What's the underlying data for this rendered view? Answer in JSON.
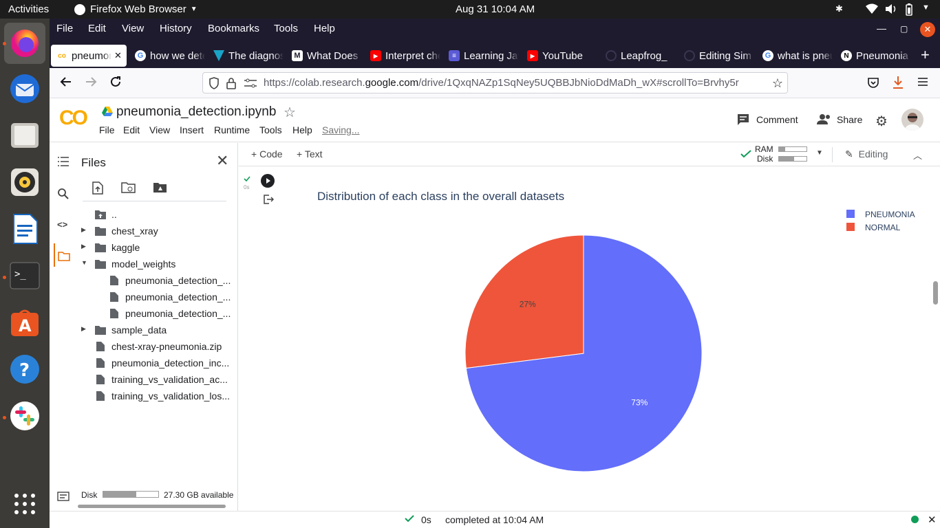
{
  "system": {
    "activities": "Activities",
    "app_name": "Firefox Web Browser",
    "clock": "Aug 31  10:04 AM"
  },
  "firefox": {
    "menu": [
      "File",
      "Edit",
      "View",
      "History",
      "Bookmarks",
      "Tools",
      "Help"
    ],
    "tabs": [
      {
        "label": "pneumonia_detection.ipynb",
        "favicon": "colab-icon",
        "active": true
      },
      {
        "label": "how we determine",
        "favicon": "google-icon"
      },
      {
        "label": "The diagnosis",
        "favicon": "triangle-icon"
      },
      {
        "label": "What Does",
        "favicon": "m-icon"
      },
      {
        "label": "Interpret chest",
        "favicon": "youtube-icon"
      },
      {
        "label": "Learning Java",
        "favicon": "doc-icon"
      },
      {
        "label": "YouTube",
        "favicon": "youtube-icon"
      },
      {
        "label": "Leapfrog_",
        "favicon": "github-icon"
      },
      {
        "label": "Editing Sim",
        "favicon": "github-icon"
      },
      {
        "label": "what is pneumonia",
        "favicon": "google-icon"
      },
      {
        "label": "Pneumonia",
        "favicon": "notion-icon"
      }
    ],
    "url_prefix": "https://colab.research.",
    "url_domain": "google.com",
    "url_path": "/drive/1QxqNAZp1SqNey5UQBBJbNioDdMaDh_wX#scrollTo=Brvhy5r"
  },
  "colab": {
    "logo": "CO",
    "notebook_title": "pneumonia_detection.ipynb",
    "menu": [
      "File",
      "Edit",
      "View",
      "Insert",
      "Runtime",
      "Tools",
      "Help"
    ],
    "saving_status": "Saving...",
    "comment_label": "Comment",
    "share_label": "Share",
    "toolbar": {
      "add_code": "Code",
      "add_text": "Text",
      "ram_label": "RAM",
      "disk_label": "Disk",
      "ram_fraction": 0.22,
      "disk_fraction": 0.55,
      "editing_label": "Editing"
    },
    "files_panel": {
      "title": "Files",
      "parent": "..",
      "items": [
        {
          "name": "chest_xray",
          "type": "folder",
          "expanded": false,
          "depth": 0
        },
        {
          "name": "kaggle",
          "type": "folder",
          "expanded": false,
          "depth": 0
        },
        {
          "name": "model_weights",
          "type": "folder",
          "expanded": true,
          "depth": 0
        },
        {
          "name": "pneumonia_detection_...",
          "type": "file",
          "depth": 1
        },
        {
          "name": "pneumonia_detection_...",
          "type": "file",
          "depth": 1
        },
        {
          "name": "pneumonia_detection_...",
          "type": "file",
          "depth": 1
        },
        {
          "name": "sample_data",
          "type": "folder",
          "expanded": false,
          "depth": 0
        },
        {
          "name": "chest-xray-pneumonia.zip",
          "type": "file",
          "depth": 0
        },
        {
          "name": "pneumonia_detection_inc...",
          "type": "file",
          "depth": 0
        },
        {
          "name": "training_vs_validation_ac...",
          "type": "file",
          "depth": 0
        },
        {
          "name": "training_vs_validation_los...",
          "type": "file",
          "depth": 0
        }
      ],
      "disk_label": "Disk",
      "disk_fraction": 0.6,
      "disk_available": "27.30 GB available"
    },
    "cell": {
      "exec_time": "0s"
    },
    "status": {
      "time": "0s",
      "message": "completed at 10:04 AM"
    }
  },
  "chart_data": {
    "type": "pie",
    "title": "Distribution of each class in the overall datasets",
    "slices": [
      {
        "label": "PNEUMONIA",
        "value": 73,
        "display": "73%",
        "color": "#636efa"
      },
      {
        "label": "NORMAL",
        "value": 27,
        "display": "27%",
        "color": "#ef553b"
      }
    ],
    "legend_position": "top-right"
  }
}
